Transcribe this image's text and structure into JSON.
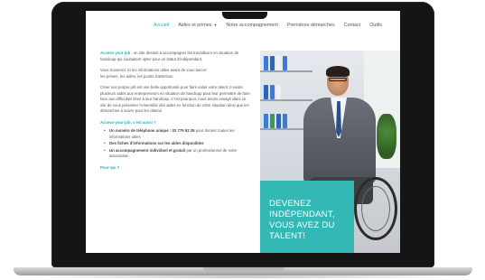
{
  "nav": {
    "items": [
      {
        "label": "Accueil",
        "active": true
      },
      {
        "label": "Aides et primes",
        "has_dropdown": true
      },
      {
        "label": "Notre accompagnement"
      },
      {
        "label": "Premières démarches"
      },
      {
        "label": "Contact"
      },
      {
        "label": "Outils"
      }
    ]
  },
  "content": {
    "intro_highlight": "Access your job",
    "intro_rest": " : un site destiné à accompagner les travailleurs en situation de handicap qui souhaitent opter pour un statut d'indépendant.",
    "info_line_1": "Vous trouverez ici les informations utiles avant de vous lancer:",
    "info_line_2": "les primes, les aides, les points d'attention.",
    "paragraph_3": "Créer son propre job est une belle opportunité pour faire valoir votre talent. Il existe plusieurs aides aux entrepreneurs en situation de handicap pour leur permettre de faire face aux difficultés liées à leur handicap. C'est pourquoi, nous avons essayé dans ce site de vous présenter l'ensemble des aides en fonction de votre situation ainsi que les démarches à suivre pour les obtenir",
    "section_title": "Access-your-job, c'est aussi ?",
    "bullets": [
      {
        "bold": "Un numéro de téléphone unique : 02 779 92 29",
        "rest": " pour donner toutes les informations utiles"
      },
      {
        "bold": "Des fiches d'informations sur les aides disponibles",
        "rest": ""
      },
      {
        "bold": "Un accompagnement individuel et gratuit",
        "rest": " par un professionnel de notre association"
      }
    ],
    "next_title": "Pour qui ?"
  },
  "hero": {
    "cta_text": "DEVENEZ INDÉPENDANT, VOUS AVEZ DU TALENT!"
  },
  "colors": {
    "accent": "#34b8b5",
    "nav_active": "#27b3b0",
    "laptop_bezel": "#151515"
  }
}
